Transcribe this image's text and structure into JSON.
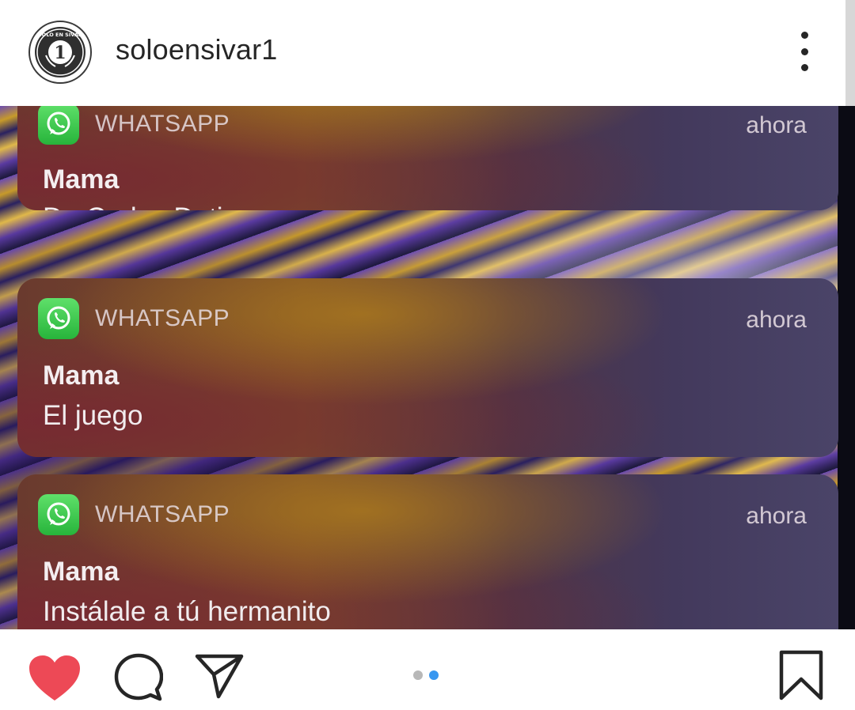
{
  "header": {
    "avatar_brand_text": "SOLO EN SIVAR 1",
    "username": "soloensivar1",
    "more_icon": "more-vertical-icon"
  },
  "post": {
    "notifications": [
      {
        "app": "WHATSAPP",
        "time": "ahora",
        "sender": "Mama",
        "message": "De Carlos Duti"
      },
      {
        "app": "WHATSAPP",
        "time": "ahora",
        "sender": "Mama",
        "message": "El juego"
      },
      {
        "app": "WHATSAPP",
        "time": "ahora",
        "sender": "Mama",
        "message": "Instálale a tú hermanito"
      }
    ],
    "carousel": {
      "total": 2,
      "current": 2
    }
  },
  "actions": {
    "like_icon": "heart-icon",
    "comment_icon": "comment-icon",
    "share_icon": "send-icon",
    "save_icon": "bookmark-icon",
    "like_color": "#ed4956",
    "active_dot_color": "#3897f0"
  }
}
